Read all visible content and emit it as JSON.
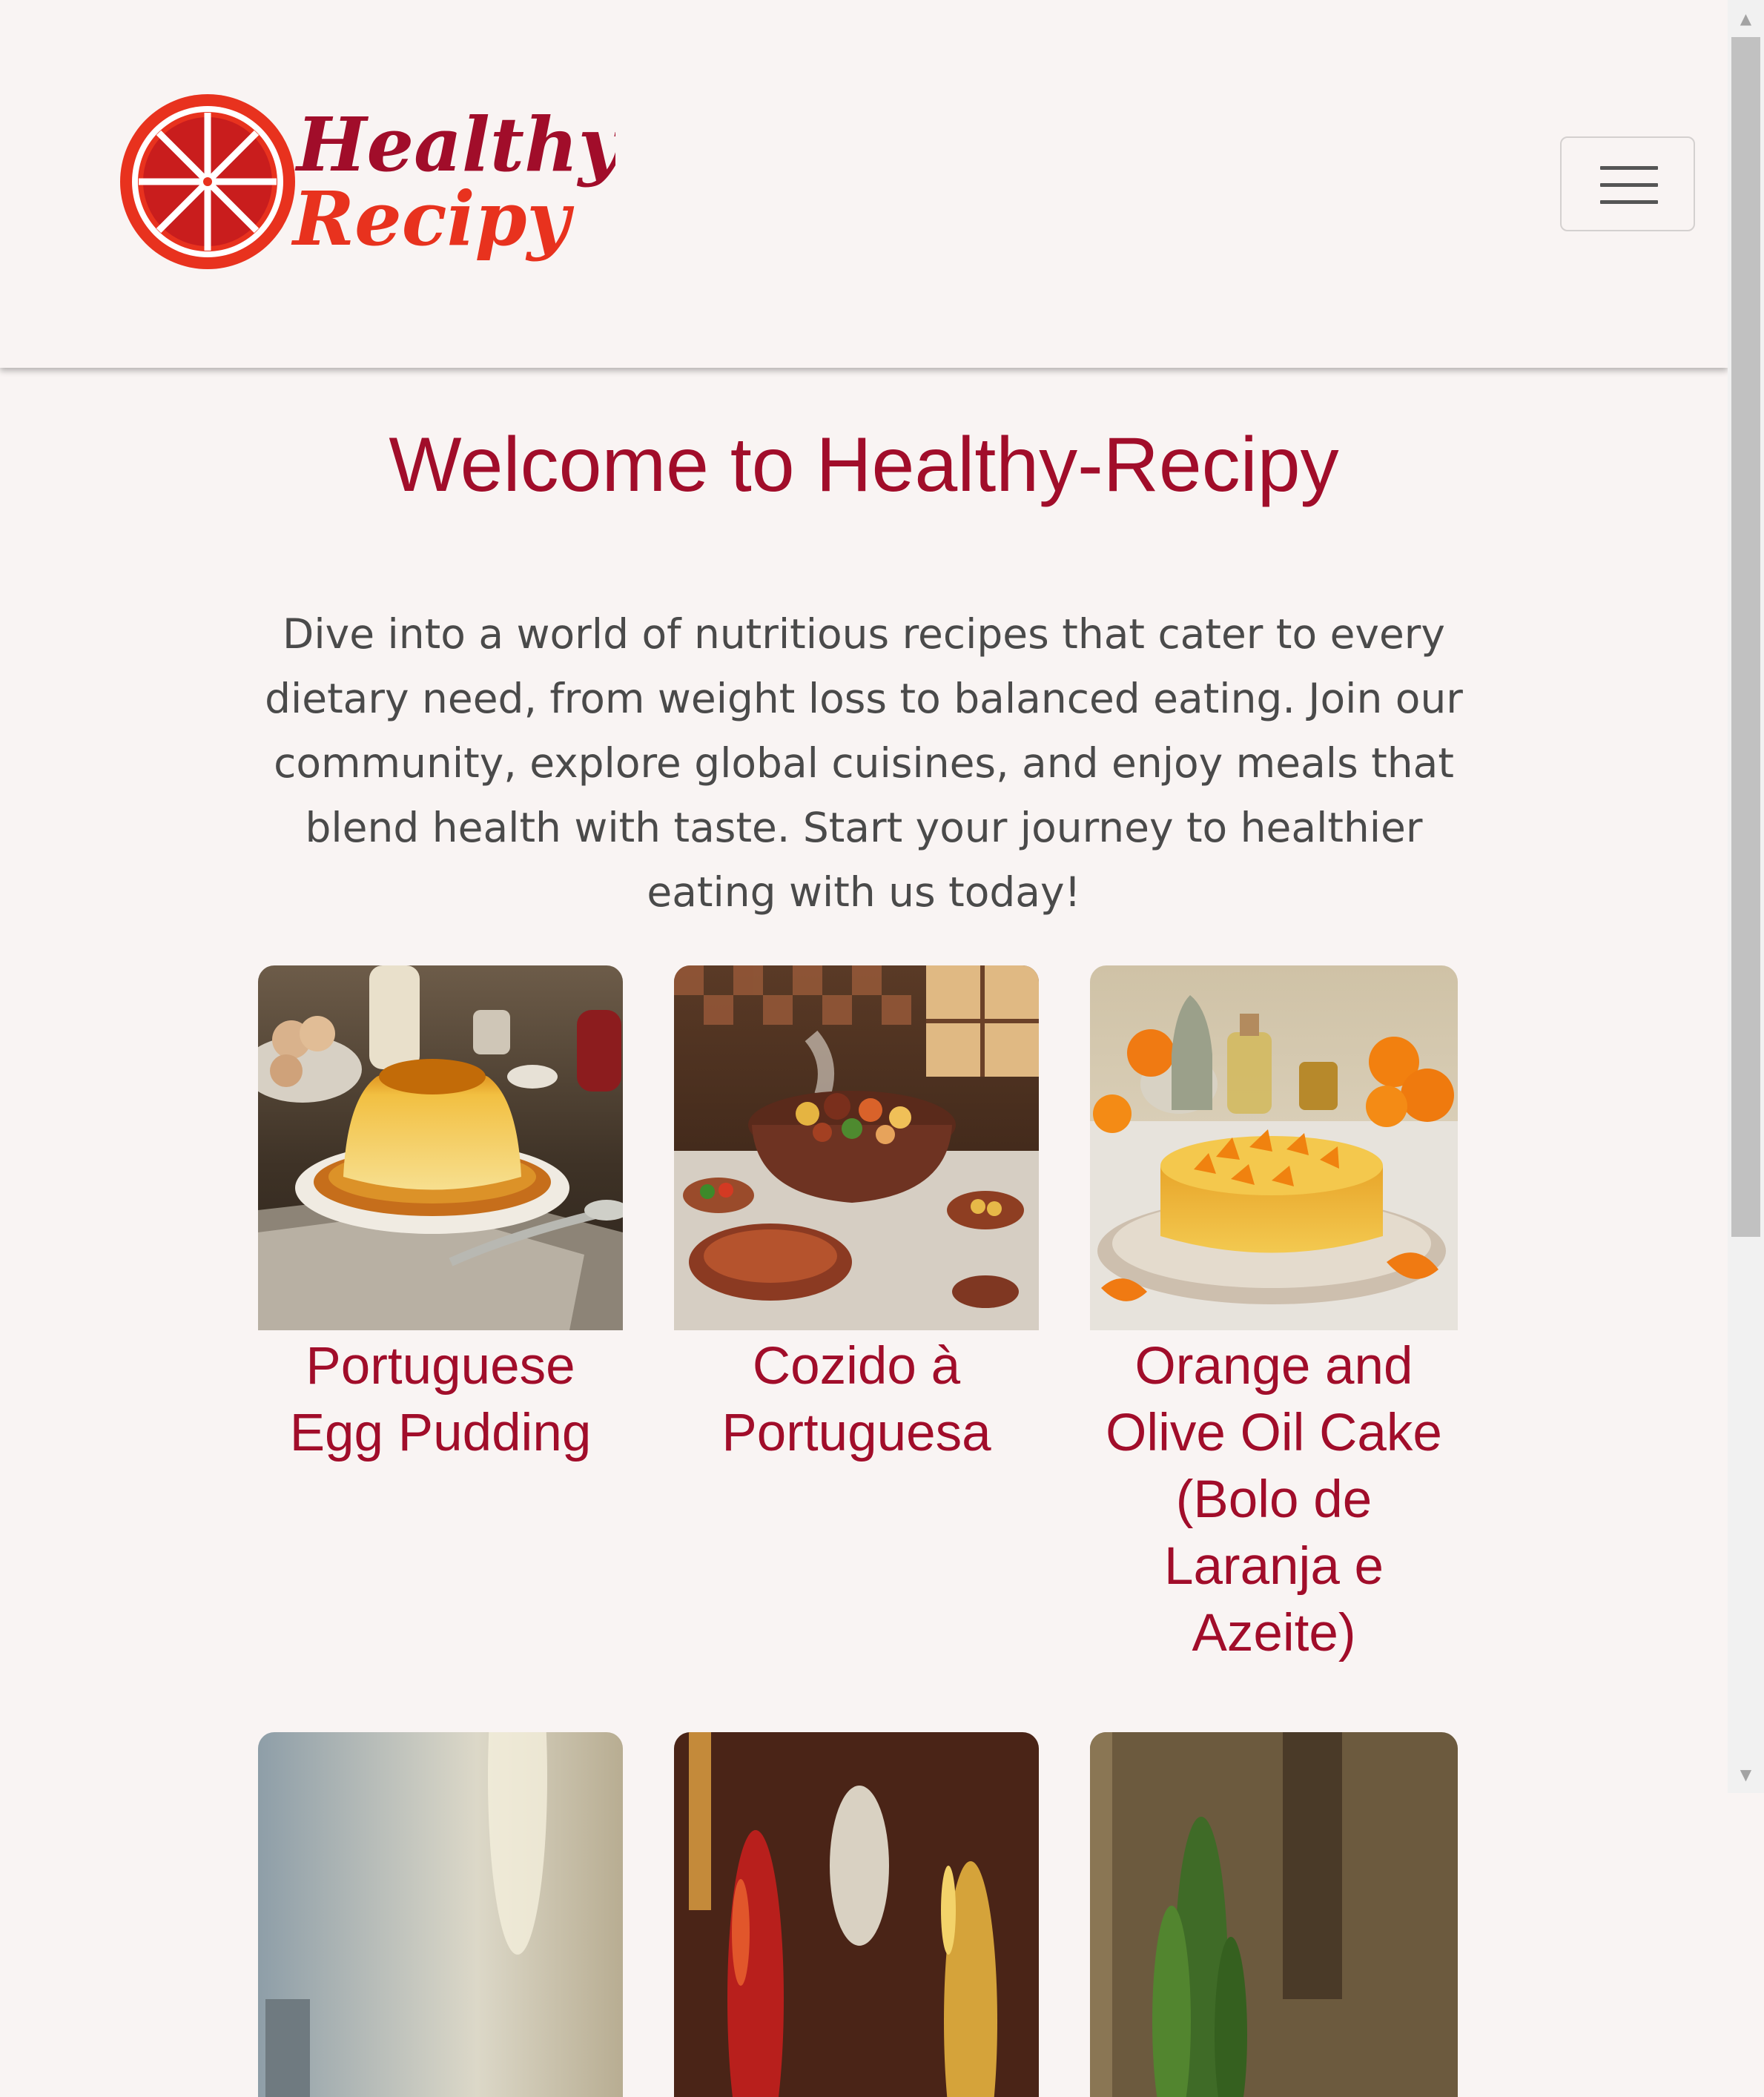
{
  "header": {
    "logo_line1": "Healthy",
    "logo_line2": "Recipy",
    "menu_icon": "hamburger-menu-icon"
  },
  "main": {
    "title": "Welcome to Healthy-Recipy",
    "intro": "Dive into a world of nutritious recipes that cater to every dietary need, from weight loss to balanced eating. Join our community, explore global cuisines, and enjoy meals that blend health with taste. Start your journey to healthier eating with us today!"
  },
  "recipes": [
    {
      "name": "Portuguese Egg Pudding"
    },
    {
      "name": "Cozido à Portuguesa"
    },
    {
      "name": "Orange and Olive Oil Cake (Bolo de Laranja e Azeite)"
    }
  ],
  "colors": {
    "brand": "#a10d2a",
    "logo_red": "#e8321e",
    "background": "#f9f4f3",
    "body_text": "#4a4a4a"
  }
}
